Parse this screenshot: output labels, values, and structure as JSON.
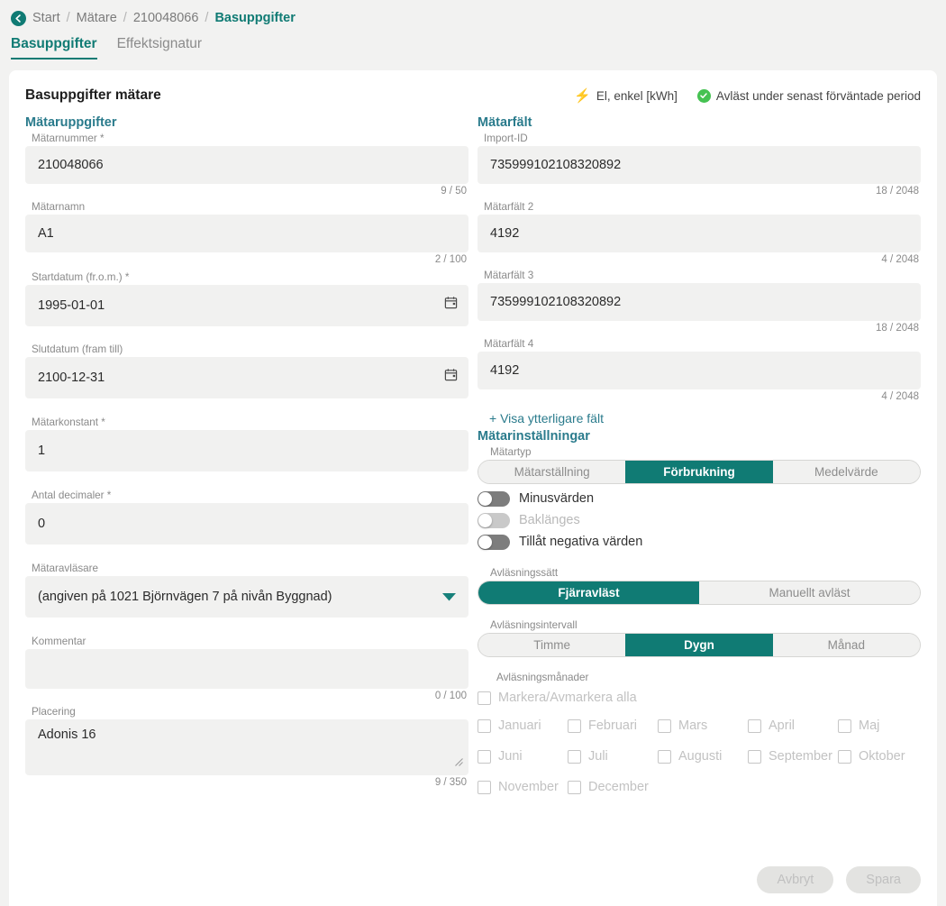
{
  "breadcrumb": {
    "back_icon": "back-arrow-icon",
    "items": [
      {
        "label": "Start",
        "current": false
      },
      {
        "label": "Mätare",
        "current": false
      },
      {
        "label": "210048066",
        "current": false
      },
      {
        "label": "Basuppgifter",
        "current": true
      }
    ],
    "separator": "/"
  },
  "tabs": [
    {
      "label": "Basuppgifter",
      "active": true
    },
    {
      "label": "Effektsignatur",
      "active": false
    }
  ],
  "card": {
    "title": "Basuppgifter mätare",
    "status": {
      "meter_type": "El, enkel [kWh]",
      "meter_type_icon": "lightning-bolt-icon",
      "read_status": "Avläst under senast förväntade period",
      "read_status_icon": "check-circle-icon"
    }
  },
  "left": {
    "section_title": "Mätaruppgifter",
    "fields": [
      {
        "label": "Mätarnummer *",
        "value": "210048066",
        "counter": "9 / 50"
      },
      {
        "label": "Mätarnamn",
        "value": "A1",
        "counter": "2 / 100"
      },
      {
        "label": "Startdatum (fr.o.m.) *",
        "value": "1995-01-01",
        "icon": "calendar-icon"
      },
      {
        "label": "Slutdatum (fram till)",
        "value": "2100-12-31",
        "icon": "calendar-icon"
      },
      {
        "label": "Mätarkonstant *",
        "value": "1"
      },
      {
        "label": "Antal decimaler *",
        "value": "0"
      },
      {
        "label": "Mätaravläsare",
        "value": "(angiven på 1021 Björnvägen 7 på nivån Byggnad)",
        "icon": "chevron-down-icon"
      },
      {
        "label": "Kommentar",
        "value": "",
        "counter": "0 / 100"
      },
      {
        "label": "Placering",
        "value": "Adonis 16",
        "counter": "9 / 350"
      }
    ]
  },
  "right": {
    "section_title": "Mätarfält",
    "fields": [
      {
        "label": "Import-ID",
        "value": "735999102108320892",
        "counter": "18 / 2048"
      },
      {
        "label": "Mätarfält 2",
        "value": "4192",
        "counter": "4 / 2048"
      },
      {
        "label": "Mätarfält 3",
        "value": "735999102108320892",
        "counter": "18 / 2048"
      },
      {
        "label": "Mätarfält 4",
        "value": "4192",
        "counter": "4 / 2048"
      }
    ],
    "extra_fields_link": "+ Visa ytterligare fält",
    "settings_title": "Mätarinställningar",
    "meter_type": {
      "label": "Mätartyp",
      "options": [
        "Mätarställning",
        "Förbrukning",
        "Medelvärde"
      ],
      "selected": "Förbrukning"
    },
    "toggles": [
      {
        "label": "Minusvärden",
        "on": false,
        "disabled": false
      },
      {
        "label": "Baklänges",
        "on": false,
        "disabled": true
      },
      {
        "label": "Tillåt negativa värden",
        "on": false,
        "disabled": false
      }
    ],
    "reading_method": {
      "label": "Avläsningssätt",
      "options": [
        "Fjärravläst",
        "Manuellt avläst"
      ],
      "selected": "Fjärravläst"
    },
    "reading_interval": {
      "label": "Avläsningsintervall",
      "options": [
        "Timme",
        "Dygn",
        "Månad"
      ],
      "selected": "Dygn"
    },
    "reading_months": {
      "label": "Avläsningsmånader",
      "select_all": "Markera/Avmarkera alla",
      "months": [
        "Januari",
        "Februari",
        "Mars",
        "April",
        "Maj",
        "Juni",
        "Juli",
        "Augusti",
        "September",
        "Oktober",
        "November",
        "December"
      ]
    }
  },
  "footer": {
    "cancel_label": "Avbryt",
    "save_label": "Spara"
  },
  "colors": {
    "accent_teal": "#107b74",
    "section_title": "#2a7b8c",
    "page_bg": "#f2f2f1",
    "field_bg": "#f1f1f0",
    "bolt_yellow": "#f5c518",
    "check_green": "#45c252"
  }
}
